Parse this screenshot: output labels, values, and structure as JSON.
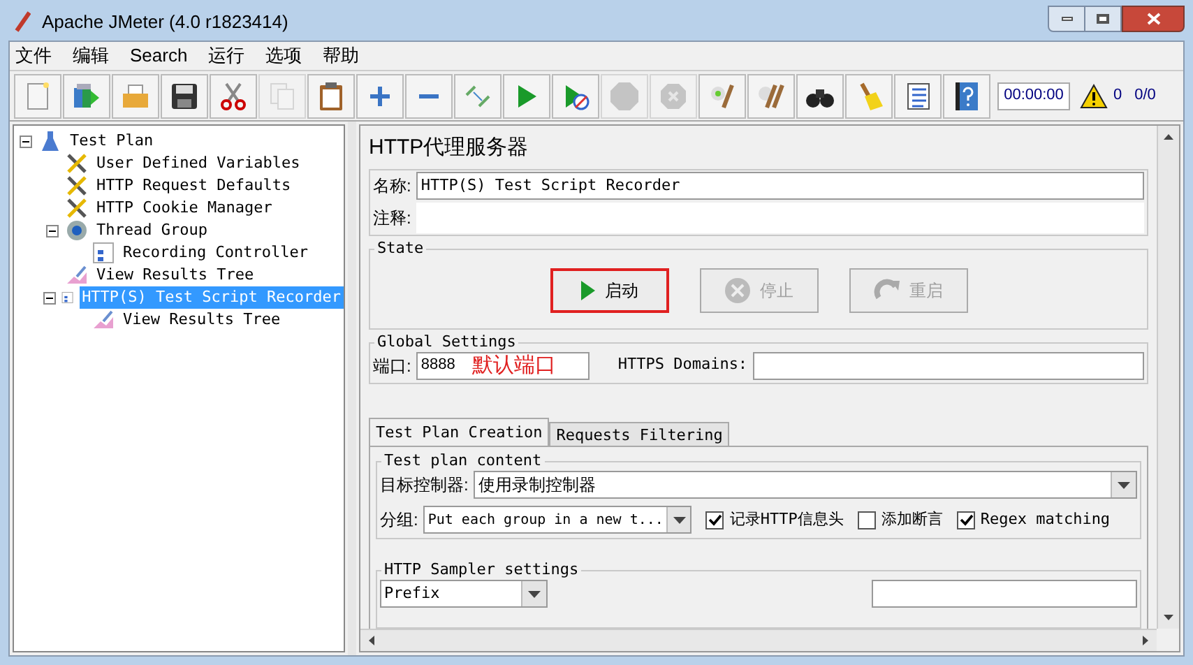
{
  "window": {
    "title": "Apache JMeter (4.0 r1823414)"
  },
  "menu": [
    "文件",
    "编辑",
    "Search",
    "运行",
    "选项",
    "帮助"
  ],
  "toolbar": [
    {
      "kind": "new",
      "disabled": false
    },
    {
      "kind": "templates",
      "disabled": false
    },
    {
      "kind": "open",
      "disabled": false
    },
    {
      "kind": "save",
      "disabled": false
    },
    {
      "kind": "cut",
      "disabled": false
    },
    {
      "kind": "copy",
      "disabled": true
    },
    {
      "kind": "paste",
      "disabled": false
    },
    {
      "kind": "expand",
      "disabled": false
    },
    {
      "kind": "collapse",
      "disabled": false
    },
    {
      "kind": "toggle",
      "disabled": false
    },
    {
      "kind": "start",
      "disabled": false
    },
    {
      "kind": "start_no_pause",
      "disabled": false
    },
    {
      "kind": "stop",
      "disabled": true
    },
    {
      "kind": "shutdown",
      "disabled": true
    },
    {
      "kind": "clear",
      "disabled": false
    },
    {
      "kind": "clear_all",
      "disabled": false
    },
    {
      "kind": "search",
      "disabled": false
    },
    {
      "kind": "reset_search",
      "disabled": false
    },
    {
      "kind": "function_helper",
      "disabled": false
    },
    {
      "kind": "help",
      "disabled": false
    }
  ],
  "timer": "00:00:00",
  "warnings": "0",
  "threads": "0/0",
  "tree": [
    {
      "label": "Test Plan",
      "kind": "plan",
      "selected": false,
      "expanded": true,
      "children": [
        {
          "label": "User Defined Variables",
          "kind": "config",
          "selected": false
        },
        {
          "label": "HTTP Request Defaults",
          "kind": "config",
          "selected": false
        },
        {
          "label": "HTTP Cookie Manager",
          "kind": "config",
          "selected": false
        },
        {
          "label": "Thread Group",
          "kind": "threads",
          "selected": false,
          "expanded": true,
          "children": [
            {
              "label": "Recording Controller",
              "kind": "controller",
              "selected": false
            }
          ]
        },
        {
          "label": "View Results Tree",
          "kind": "listener",
          "selected": false
        },
        {
          "label": "HTTP(S) Test Script Recorder",
          "kind": "controller",
          "selected": true,
          "expanded": true,
          "children": [
            {
              "label": "View Results Tree",
              "kind": "listener",
              "selected": false
            }
          ]
        }
      ]
    }
  ],
  "panel": {
    "title": "HTTP代理服务器",
    "name_label": "名称:",
    "name_value": "HTTP(S) Test Script Recorder",
    "comment_label": "注释:",
    "state": {
      "legend": "State",
      "buttons": [
        {
          "label": "启动",
          "kind": "start",
          "disabled": false,
          "highlighted": true
        },
        {
          "label": "停止",
          "kind": "stop",
          "disabled": true,
          "highlighted": false
        },
        {
          "label": "重启",
          "kind": "restart",
          "disabled": true,
          "highlighted": false
        }
      ]
    },
    "global": {
      "legend": "Global Settings",
      "port_label": "端口:",
      "port_value": "8888",
      "port_note": "默认端口",
      "https_label": "HTTPS Domains:"
    },
    "tabs": [
      {
        "label": "Test Plan Creation",
        "selected": true
      },
      {
        "label": "Requests Filtering",
        "selected": false
      }
    ],
    "content": {
      "legend": "Test plan content",
      "target_label": "目标控制器:",
      "target_value": "使用录制控制器",
      "group_label": "分组:",
      "group_value": "Put each group in a new t...",
      "checks": [
        {
          "label": "记录HTTP信息头",
          "checked": true
        },
        {
          "label": "添加断言",
          "checked": false
        },
        {
          "label": "Regex matching",
          "checked": true
        }
      ]
    },
    "sampler": {
      "legend": "HTTP Sampler settings",
      "prefix_value": "Prefix"
    }
  }
}
